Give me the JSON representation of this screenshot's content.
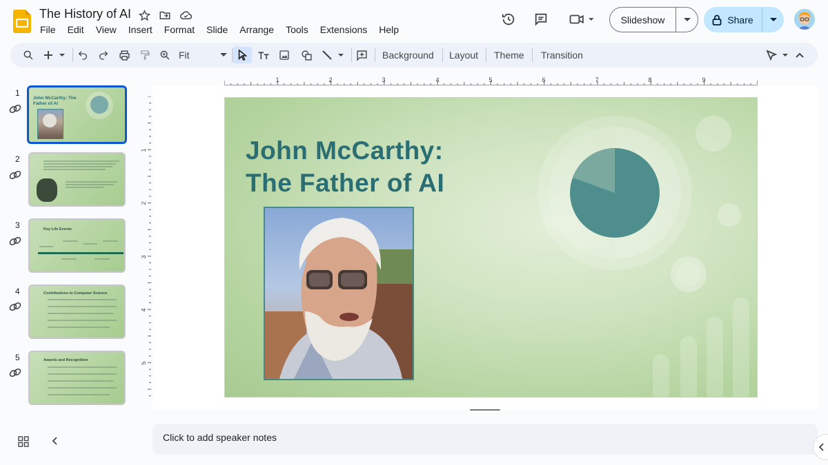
{
  "header": {
    "doc_title": "The History of AI",
    "menu": [
      "File",
      "Edit",
      "View",
      "Insert",
      "Format",
      "Slide",
      "Arrange",
      "Tools",
      "Extensions",
      "Help"
    ],
    "slideshow_label": "Slideshow",
    "share_label": "Share"
  },
  "toolbar": {
    "zoom_label": "Fit",
    "buttons": [
      "Background",
      "Layout",
      "Theme",
      "Transition"
    ]
  },
  "ruler": {
    "h_labels": [
      "1",
      "2",
      "3",
      "4",
      "5",
      "6",
      "7",
      "8",
      "9"
    ],
    "v_labels": [
      "1",
      "2",
      "3",
      "4",
      "5"
    ]
  },
  "filmstrip": {
    "slides": [
      {
        "number": "1",
        "title": "John McCarthy: The Father of AI"
      },
      {
        "number": "2",
        "title": ""
      },
      {
        "number": "3",
        "title": "Key Life Events"
      },
      {
        "number": "4",
        "title": "Contributions to Computer Science"
      },
      {
        "number": "5",
        "title": "Awards and Recognition"
      }
    ]
  },
  "slide": {
    "title": "John McCarthy:\nThe Father of AI"
  },
  "notes": {
    "placeholder": "Click to add speaker notes"
  },
  "colors": {
    "accent": "#2a6e73",
    "selection": "#0b57d0",
    "share_bg": "#c2e7ff"
  }
}
